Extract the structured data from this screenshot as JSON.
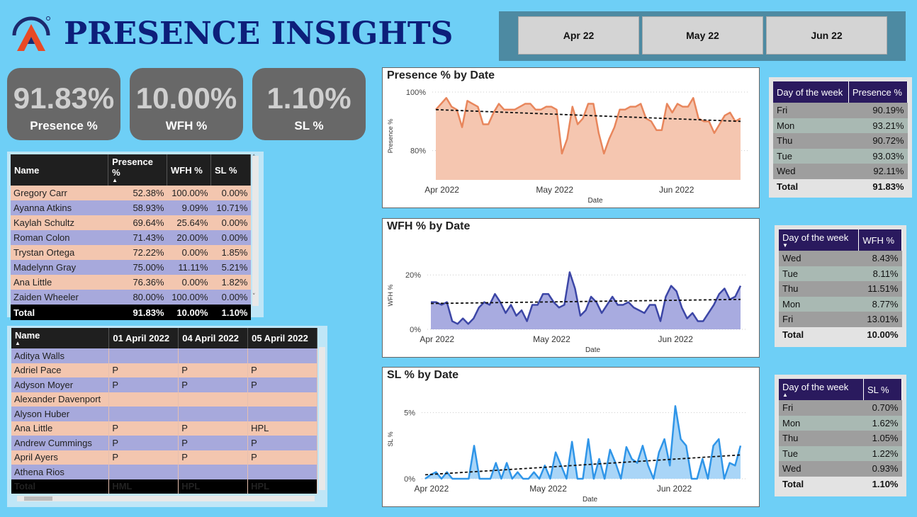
{
  "header": {
    "title": "PRESENCE INSIGHTS"
  },
  "slicer": {
    "items": [
      "Apr 22",
      "May 22",
      "Jun 22"
    ]
  },
  "kpis": [
    {
      "value": "91.83%",
      "label": "Presence %"
    },
    {
      "value": "10.00%",
      "label": "WFH %"
    },
    {
      "value": "1.10%",
      "label": "SL %"
    }
  ],
  "name_table": {
    "columns": [
      "Name",
      "Presence %",
      "WFH %",
      "SL %"
    ],
    "rows": [
      [
        "Gregory Carr",
        "52.38%",
        "100.00%",
        "0.00%"
      ],
      [
        "Ayanna Atkins",
        "58.93%",
        "9.09%",
        "10.71%"
      ],
      [
        "Kaylah Schultz",
        "69.64%",
        "25.64%",
        "0.00%"
      ],
      [
        "Roman Colon",
        "71.43%",
        "20.00%",
        "0.00%"
      ],
      [
        "Trystan Ortega",
        "72.22%",
        "0.00%",
        "1.85%"
      ],
      [
        "Madelynn Gray",
        "75.00%",
        "11.11%",
        "5.21%"
      ],
      [
        "Ana Little",
        "76.36%",
        "0.00%",
        "1.82%"
      ],
      [
        "Zaiden Wheeler",
        "80.00%",
        "100.00%",
        "0.00%"
      ]
    ],
    "total": [
      "Total",
      "91.83%",
      "10.00%",
      "1.10%"
    ]
  },
  "attendance_table": {
    "columns": [
      "Name",
      "01 April 2022",
      "04 April 2022",
      "05 April 2022"
    ],
    "rows": [
      [
        "Aditya Walls",
        "",
        "",
        ""
      ],
      [
        "Adriel Pace",
        "P",
        "P",
        "P"
      ],
      [
        "Adyson Moyer",
        "P",
        "P",
        "P"
      ],
      [
        "Alexander Davenport",
        "",
        "",
        ""
      ],
      [
        "Alyson Huber",
        "",
        "",
        ""
      ],
      [
        "Ana Little",
        "P",
        "P",
        "HPL"
      ],
      [
        "Andrew Cummings",
        "P",
        "P",
        "P"
      ],
      [
        "April Ayers",
        "P",
        "P",
        "P"
      ],
      [
        "Athena Rios",
        "",
        "",
        ""
      ]
    ],
    "total": [
      "Total",
      "HML",
      "HPL",
      "HPL"
    ]
  },
  "presence_by_day": {
    "columns": [
      "Day of the week",
      "Presence %"
    ],
    "rows": [
      [
        "Fri",
        "90.19%"
      ],
      [
        "Mon",
        "93.21%"
      ],
      [
        "Thu",
        "90.72%"
      ],
      [
        "Tue",
        "93.03%"
      ],
      [
        "Wed",
        "92.11%"
      ]
    ],
    "total": [
      "Total",
      "91.83%"
    ]
  },
  "wfh_by_day": {
    "columns": [
      "Day of the week",
      "WFH %"
    ],
    "rows": [
      [
        "Wed",
        "8.43%"
      ],
      [
        "Tue",
        "8.11%"
      ],
      [
        "Thu",
        "11.51%"
      ],
      [
        "Mon",
        "8.77%"
      ],
      [
        "Fri",
        "13.01%"
      ]
    ],
    "total": [
      "Total",
      "10.00%"
    ]
  },
  "sl_by_day": {
    "columns": [
      "Day of the week",
      "SL %"
    ],
    "rows": [
      [
        "Fri",
        "0.70%"
      ],
      [
        "Mon",
        "1.62%"
      ],
      [
        "Thu",
        "1.05%"
      ],
      [
        "Tue",
        "1.22%"
      ],
      [
        "Wed",
        "0.93%"
      ]
    ],
    "total": [
      "Total",
      "1.10%"
    ]
  },
  "chart_data": [
    {
      "type": "area",
      "title": "Presence % by Date",
      "xlabel": "Date",
      "ylabel": "Presence %",
      "x_ticks": [
        "Apr 2022",
        "May 2022",
        "Jun 2022"
      ],
      "y_ticks": [
        "80%",
        "100%"
      ],
      "ylim": [
        70,
        100
      ],
      "color": "#e8865c",
      "fill": "#f5c6b0",
      "values": [
        94,
        96,
        98,
        95,
        94,
        88,
        97,
        96,
        95,
        89,
        89,
        93,
        96,
        94,
        94,
        94,
        95,
        96,
        96,
        94,
        94,
        95,
        95,
        94,
        79,
        84,
        95,
        89,
        91,
        96,
        96,
        86,
        79,
        84,
        88,
        94,
        94,
        95,
        95,
        96,
        91,
        90,
        87,
        87,
        96,
        93,
        96,
        95,
        95,
        98,
        91,
        90,
        90,
        86,
        89,
        92,
        93,
        90,
        91
      ],
      "trend": [
        94,
        90
      ]
    },
    {
      "type": "area",
      "title": "WFH % by Date",
      "xlabel": "Date",
      "ylabel": "WFH %",
      "x_ticks": [
        "Apr 2022",
        "May 2022",
        "Jun 2022"
      ],
      "y_ticks": [
        "0%",
        "20%"
      ],
      "ylim": [
        0,
        25
      ],
      "color": "#3c46a6",
      "fill": "#a8abe0",
      "values": [
        10,
        10,
        9,
        10,
        3,
        2,
        4,
        2,
        4,
        8,
        10,
        9,
        13,
        10,
        6,
        9,
        5,
        7,
        3,
        9,
        9,
        13,
        13,
        10,
        8,
        9,
        21,
        15,
        5,
        7,
        12,
        10,
        6,
        9,
        12,
        9,
        9,
        10,
        8,
        7,
        6,
        9,
        9,
        3,
        12,
        16,
        14,
        8,
        4,
        6,
        3,
        3,
        6,
        9,
        13,
        15,
        11,
        12,
        16
      ],
      "trend": [
        9.5,
        11
      ]
    },
    {
      "type": "area",
      "title": "SL % by Date",
      "xlabel": "Date",
      "ylabel": "SL %",
      "x_ticks": [
        "Apr 2022",
        "May 2022",
        "Jun 2022"
      ],
      "y_ticks": [
        "0%",
        "5%"
      ],
      "ylim": [
        0,
        6
      ],
      "color": "#2f95e8",
      "fill": "#a9d5f7",
      "values": [
        0,
        0.3,
        0.5,
        0,
        0.5,
        0,
        0,
        0,
        0,
        2.5,
        0,
        0,
        0,
        1.2,
        0,
        1.2,
        0,
        0.5,
        0,
        0,
        0.5,
        0,
        1,
        0,
        2,
        1,
        0,
        2.8,
        0,
        0,
        3,
        0,
        1.5,
        0,
        2.2,
        1.2,
        0,
        2.4,
        1.5,
        1.2,
        2.5,
        1,
        0,
        2,
        3,
        1,
        5.5,
        3,
        2.5,
        0,
        0,
        1.5,
        0,
        2.5,
        3,
        0,
        1.2,
        1,
        2.5
      ],
      "trend": [
        0.3,
        1.8
      ]
    }
  ]
}
